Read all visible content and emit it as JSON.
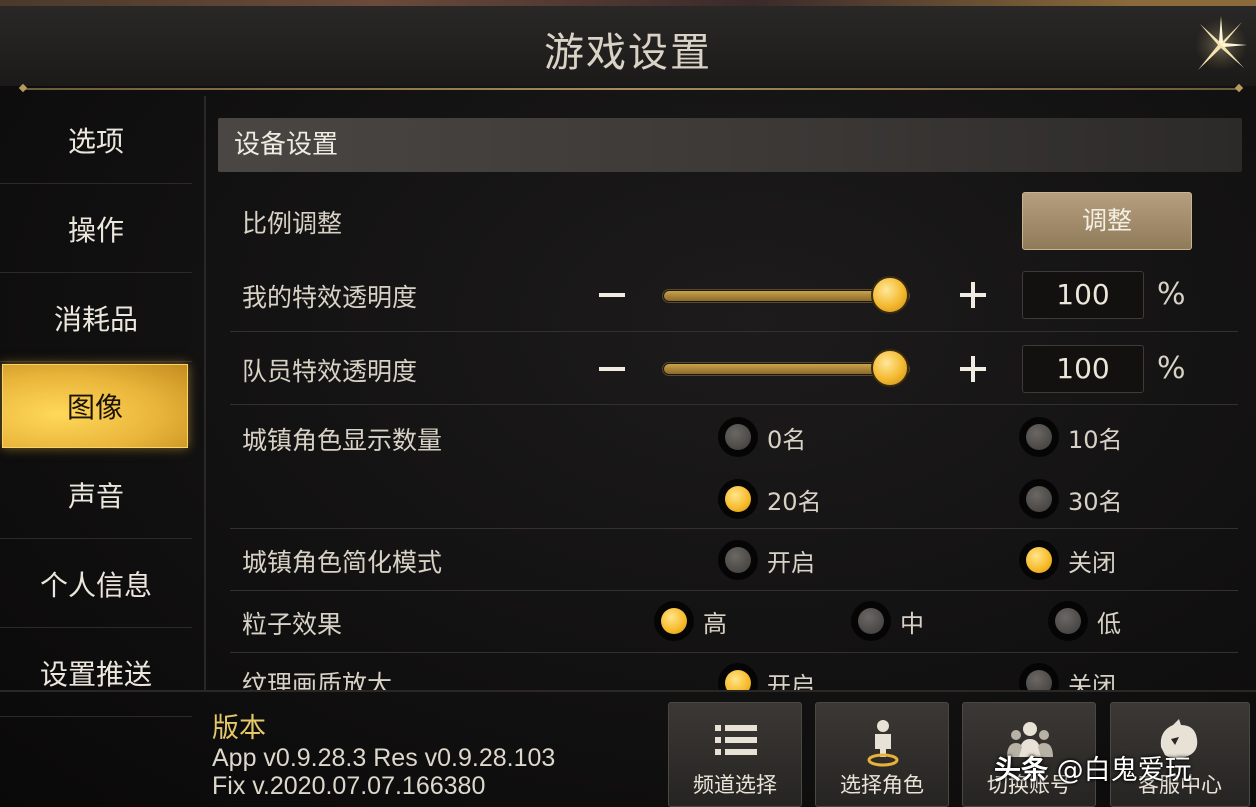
{
  "window": {
    "title": "游戏设置",
    "close_icon": "close-x-sparkle-icon"
  },
  "sidebar": {
    "items": [
      {
        "label": "选项",
        "active": false
      },
      {
        "label": "操作",
        "active": false
      },
      {
        "label": "消耗品",
        "active": false
      },
      {
        "label": "图像",
        "active": true
      },
      {
        "label": "声音",
        "active": false
      },
      {
        "label": "个人信息",
        "active": false
      },
      {
        "label": "设置推送",
        "active": false
      }
    ]
  },
  "content": {
    "section_title": "设备设置",
    "scale": {
      "label": "比例调整",
      "button_label": "调整"
    },
    "my_effect": {
      "label": "我的特效透明度",
      "value": "100",
      "unit": "%",
      "fraction": 1.0
    },
    "team_effect": {
      "label": "队员特效透明度",
      "value": "100",
      "unit": "%",
      "fraction": 1.0
    },
    "town_count": {
      "label": "城镇角色显示数量",
      "options": [
        {
          "label": "0名",
          "selected": false
        },
        {
          "label": "10名",
          "selected": false
        },
        {
          "label": "20名",
          "selected": true
        },
        {
          "label": "30名",
          "selected": false
        }
      ]
    },
    "town_simple": {
      "label": "城镇角色简化模式",
      "options": [
        {
          "label": "开启",
          "selected": false
        },
        {
          "label": "关闭",
          "selected": true
        }
      ]
    },
    "particles": {
      "label": "粒子效果",
      "options": [
        {
          "label": "高",
          "selected": true
        },
        {
          "label": "中",
          "selected": false
        },
        {
          "label": "低",
          "selected": false
        }
      ]
    },
    "texture": {
      "label": "纹理画质放大",
      "options": [
        {
          "label": "开启",
          "selected": true
        },
        {
          "label": "关闭",
          "selected": false
        }
      ]
    }
  },
  "footer": {
    "version_label": "版本",
    "version_line1": "App v0.9.28.3 Res v0.9.28.103",
    "version_line2": "Fix v.2020.07.07.166380",
    "buttons": [
      {
        "label": "频道选择",
        "icon": "list-icon"
      },
      {
        "label": "选择角色",
        "icon": "character-pin-icon"
      },
      {
        "label": "切换账号",
        "icon": "group-users-icon"
      },
      {
        "label": "客服中心",
        "icon": "support-mascot-icon"
      }
    ]
  },
  "watermark": {
    "brand": "头条",
    "handle": "@白鬼爱玩"
  },
  "colors": {
    "accent_gold": "#f3b92e",
    "active_tab": "#e9b53a",
    "panel_bg": "#121111"
  }
}
